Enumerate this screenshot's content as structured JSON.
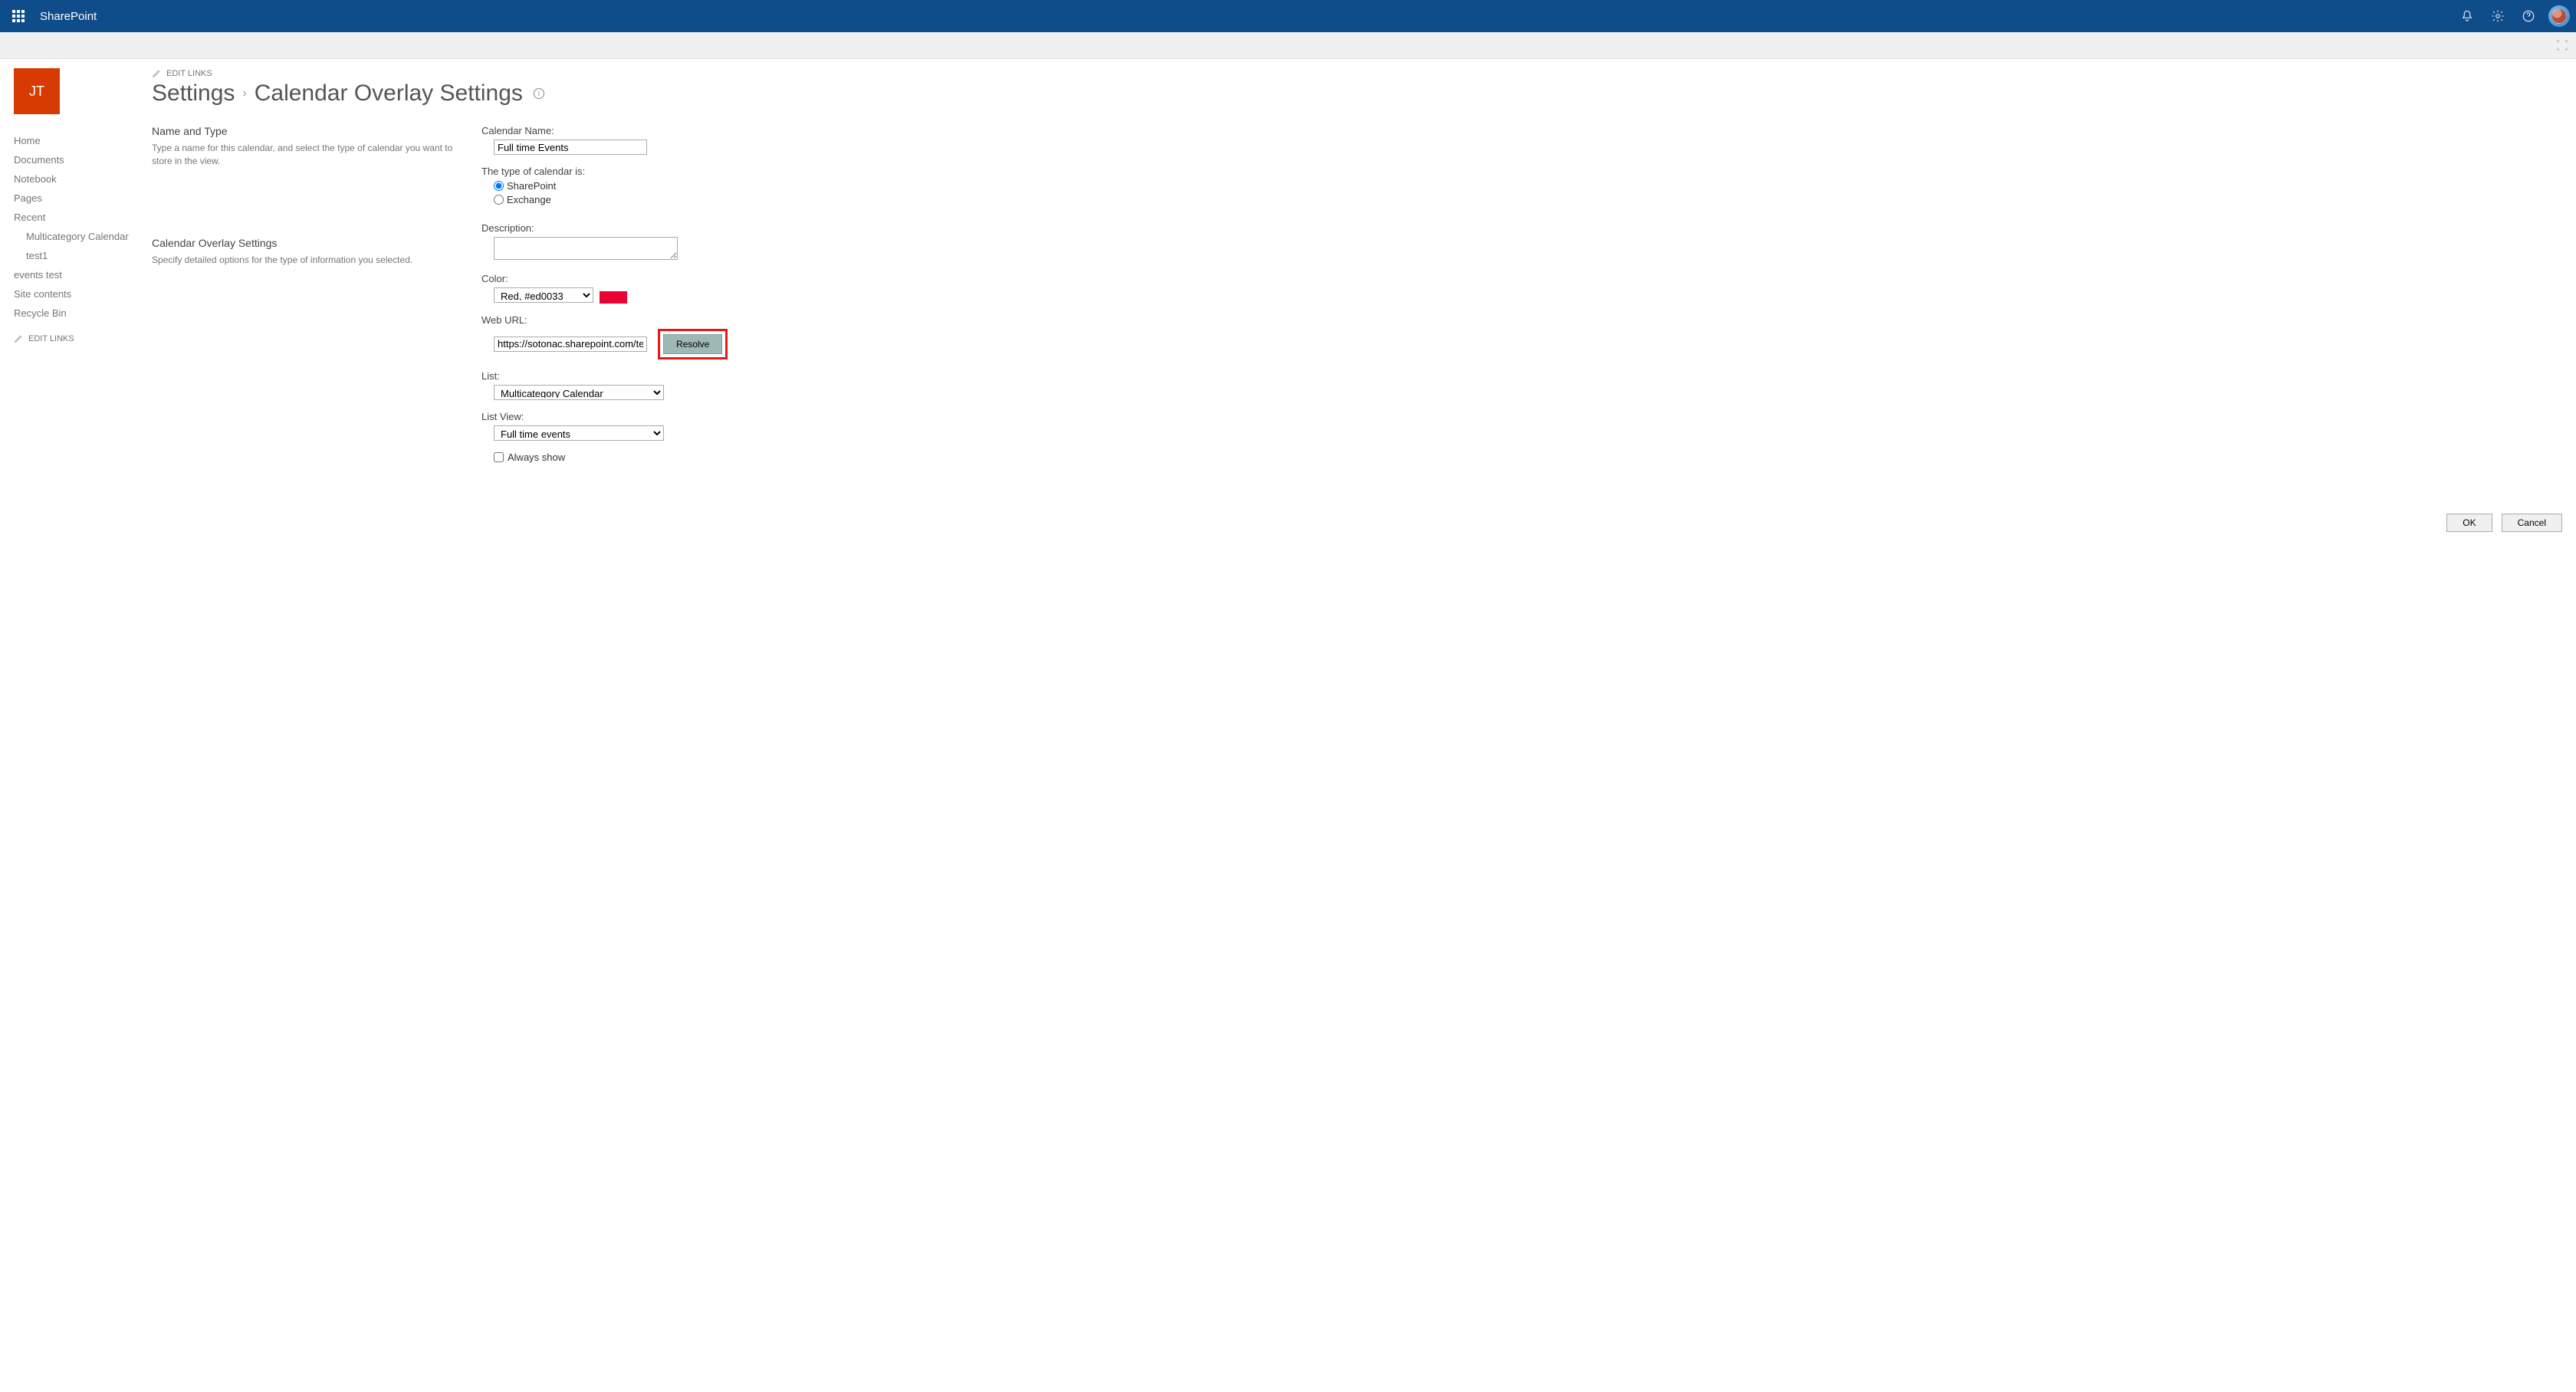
{
  "header": {
    "app_name": "SharePoint"
  },
  "site": {
    "logo_initials": "JT",
    "edit_links": "EDIT LINKS"
  },
  "breadcrumb": {
    "settings": "Settings",
    "page": "Calendar Overlay Settings"
  },
  "nav": [
    "Home",
    "Documents",
    "Notebook",
    "Pages",
    "Recent"
  ],
  "nav_recent": [
    "Multicategory Calendar",
    "test1"
  ],
  "nav_tail": [
    "events test",
    "Site contents",
    "Recycle Bin"
  ],
  "sections": {
    "name_type": {
      "title": "Name and Type",
      "desc": "Type a name for this calendar, and select the type of calendar you want to store in the view."
    },
    "overlay": {
      "title": "Calendar Overlay Settings",
      "desc": "Specify detailed options for the type of information you selected."
    }
  },
  "form": {
    "calendar_name_label": "Calendar Name:",
    "calendar_name_value": "Full time Events",
    "type_label": "The type of calendar is:",
    "radio_sharepoint": "SharePoint",
    "radio_exchange": "Exchange",
    "description_label": "Description:",
    "description_value": "",
    "color_label": "Color:",
    "color_value": "Red, #ed0033",
    "web_url_label": "Web URL:",
    "web_url_value": "https://sotonac.sharepoint.com/teams",
    "resolve": "Resolve",
    "list_label": "List:",
    "list_value": "Multicategory Calendar",
    "list_view_label": "List View:",
    "list_view_value": "Full time events",
    "always_show": "Always show"
  },
  "buttons": {
    "ok": "OK",
    "cancel": "Cancel"
  }
}
